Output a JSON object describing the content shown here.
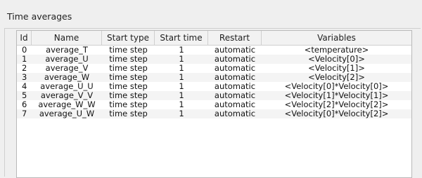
{
  "panel": {
    "title": "Time averages"
  },
  "table": {
    "columns": [
      "Id",
      "Name",
      "Start type",
      "Start time",
      "Restart",
      "Variables"
    ],
    "rows": [
      [
        "0",
        "average_T",
        "time step",
        "1",
        "automatic",
        "<temperature>"
      ],
      [
        "1",
        "average_U",
        "time step",
        "1",
        "automatic",
        "<Velocity[0]>"
      ],
      [
        "2",
        "average_V",
        "time step",
        "1",
        "automatic",
        "<Velocity[1]>"
      ],
      [
        "3",
        "average_W",
        "time step",
        "1",
        "automatic",
        "<Velocity[2]>"
      ],
      [
        "4",
        "average_U_U",
        "time step",
        "1",
        "automatic",
        "<Velocity[0]*Velocity[0]>"
      ],
      [
        "5",
        "average_V_V",
        "time step",
        "1",
        "automatic",
        "<Velocity[1]*Velocity[1]>"
      ],
      [
        "6",
        "average_W_W",
        "time step",
        "1",
        "automatic",
        "<Velocity[2]*Velocity[2]>"
      ],
      [
        "7",
        "average_U_W",
        "time step",
        "1",
        "automatic",
        "<Velocity[0]*Velocity[2]>"
      ]
    ]
  }
}
